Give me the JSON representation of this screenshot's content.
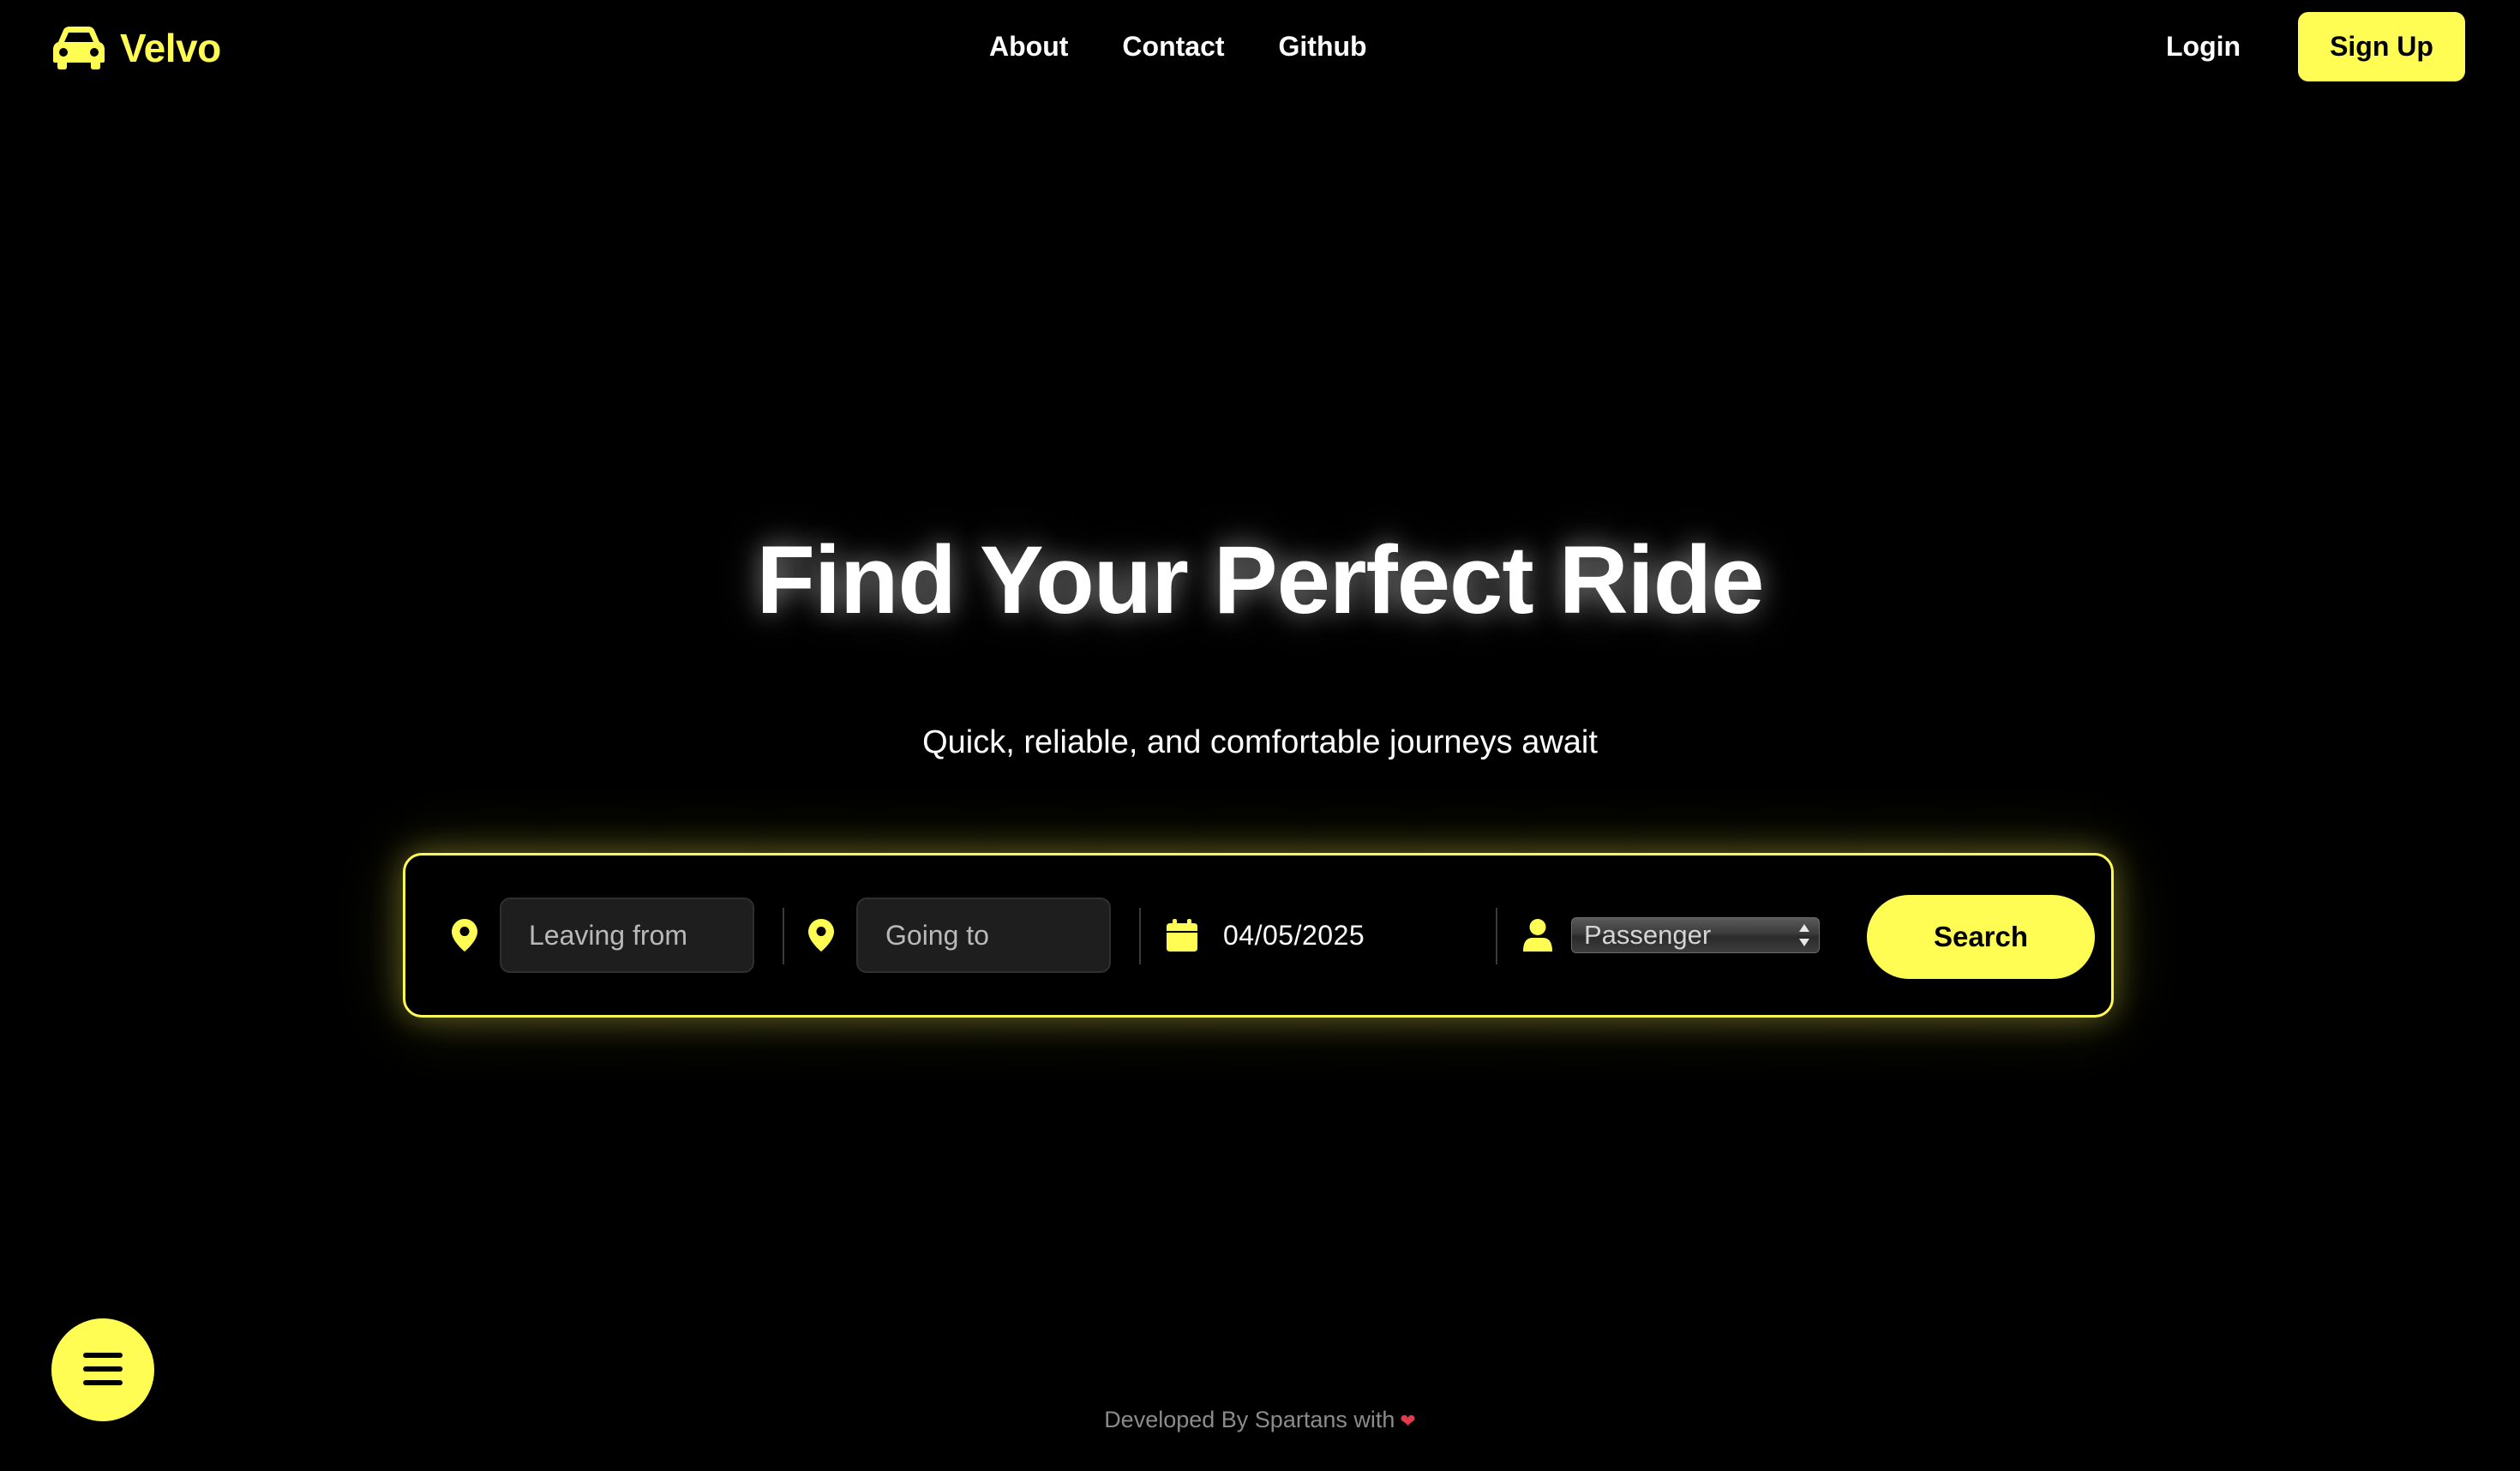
{
  "brand": {
    "name": "Velvo",
    "icon": "car-icon",
    "color": "#FFFC54"
  },
  "nav": {
    "links": [
      "About",
      "Contact",
      "Github"
    ],
    "login_label": "Login",
    "signup_label": "Sign Up"
  },
  "hero": {
    "title": "Find Your Perfect Ride",
    "subtitle": "Quick, reliable, and comfortable journeys await"
  },
  "search": {
    "leaving_from": {
      "icon": "map-pin-icon",
      "placeholder": "Leaving from",
      "value": ""
    },
    "going_to": {
      "icon": "map-pin-icon",
      "placeholder": "Going to",
      "value": ""
    },
    "date": {
      "icon": "calendar-icon",
      "value": "04/05/2025"
    },
    "passenger": {
      "icon": "user-icon",
      "selected": "Passenger"
    },
    "button_label": "Search"
  },
  "fab": {
    "icon": "menu-icon"
  },
  "footer": {
    "text": "Developed By Spartans with",
    "heart": "❤"
  },
  "colors": {
    "accent": "#FFFC54",
    "background": "#000000",
    "heart": "#e23b4a"
  }
}
